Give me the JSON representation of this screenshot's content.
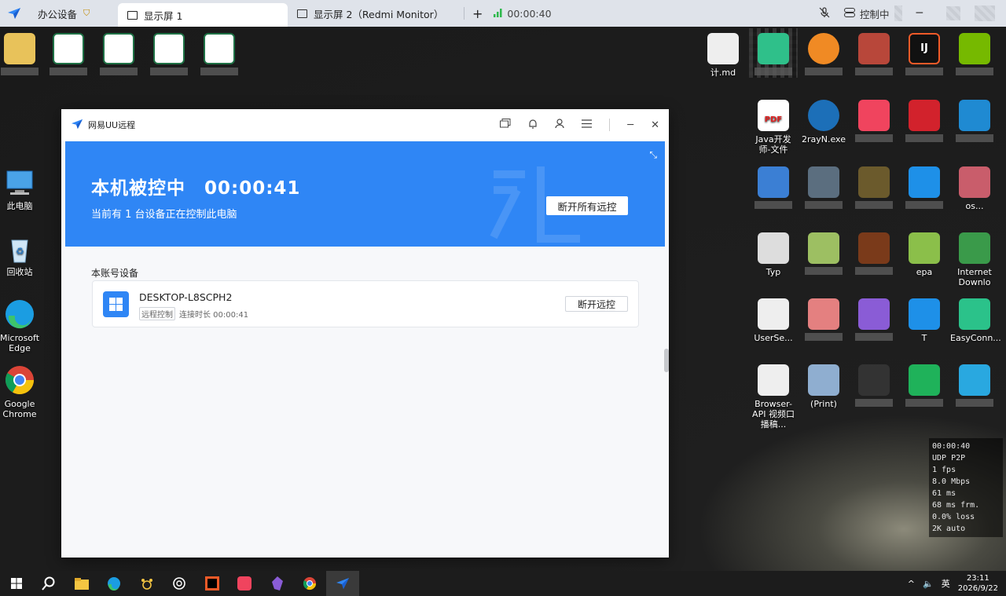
{
  "topbar": {
    "tabs": [
      {
        "label": "办公设备"
      },
      {
        "label": "显示屏 1"
      },
      {
        "label": "显示屏 2（Redmi Monitor）"
      }
    ],
    "add_label": "+",
    "session_time": "00:00:40",
    "controlling_label": "控制中"
  },
  "desktop": {
    "left_icons": [
      {
        "label": "此电脑"
      },
      {
        "label": "回收站"
      },
      {
        "label": "Microsoft Edge"
      },
      {
        "label": "Google Chrome"
      }
    ],
    "right_labels": {
      "md": "计.md",
      "pdf": "Java开发 师-文件",
      "v2ray": "2rayN.exe",
      "typ": "Typ",
      "epa": "epa",
      "idm": "Internet Downlo",
      "user": "UserSe...",
      "t": "T",
      "easy": "EasyConn...",
      "os": "os...",
      "browser": "Browser-API 视频口播稿...",
      "print": "(Print)"
    }
  },
  "window": {
    "title": "网易UU远程",
    "banner": {
      "status": "本机被控中",
      "timer": "00:00:41",
      "subtitle": "当前有 1 台设备正在控制此电脑",
      "disconnect_all": "断开所有远控"
    },
    "section_label": "本账号设备",
    "device": {
      "name": "DESKTOP-L8SCPH2",
      "badge": "远程控制",
      "duration": "连接时长 00:00:41",
      "button": "断开远控"
    }
  },
  "stats": [
    "00:00:40",
    "UDP P2P",
    "1 fps",
    "8.0 Mbps",
    "61 ms",
    "68 ms frm.",
    "0.0% loss",
    "2K auto"
  ],
  "taskbar": {
    "ime": "英",
    "time": "23:11",
    "date": "2026/9/22"
  },
  "colors": {
    "accent": "#2f86f5"
  }
}
